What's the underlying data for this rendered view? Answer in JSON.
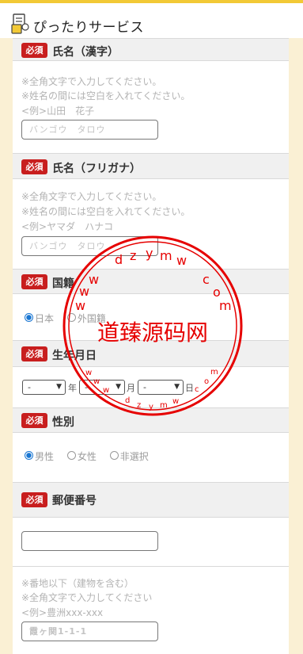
{
  "app_title": "ぴったりサービス",
  "colors": {
    "accent": "#f2c936",
    "required_badge": "#c81e1e",
    "radio_checked": "#1976d2",
    "watermark": "#e60000"
  },
  "required_label": "必須",
  "name_kanji": {
    "title": "氏名（漢字）",
    "notes": [
      "※全角文字で入力してください。",
      "※姓名の間には空白を入れてください。",
      "<例>山田　花子"
    ],
    "placeholder": "バンゴウ　タロウ"
  },
  "name_kana": {
    "title": "氏名（フリガナ）",
    "notes": [
      "※全角文字で入力してください。",
      "※姓名の間には空白を入れてください。",
      "<例>ヤマダ　ハナコ"
    ],
    "placeholder": "バンゴウ　タロウ"
  },
  "nationality": {
    "title": "国籍",
    "options": [
      "日本",
      "外国籍"
    ],
    "selected": "日本"
  },
  "birthdate": {
    "title": "生年月日",
    "year_value": "-",
    "year_unit": "年",
    "month_value": "-",
    "month_unit": "月",
    "day_value": "-",
    "day_unit": "日"
  },
  "gender": {
    "title": "性別",
    "options": [
      "男性",
      "女性",
      "非選択"
    ],
    "selected": "男性"
  },
  "postal": {
    "title": "郵便番号",
    "value": ""
  },
  "address": {
    "notes": [
      "※番地以下（建物を含む）",
      "※全角文字で入力してください",
      "<例>豊洲xxx-xxx"
    ],
    "placeholder": "霞ヶ関1-1-1"
  },
  "watermark": {
    "center_text": "道臻源码网",
    "ring_text": "wwwdzymw.com",
    "icon": "circular-stamp"
  }
}
